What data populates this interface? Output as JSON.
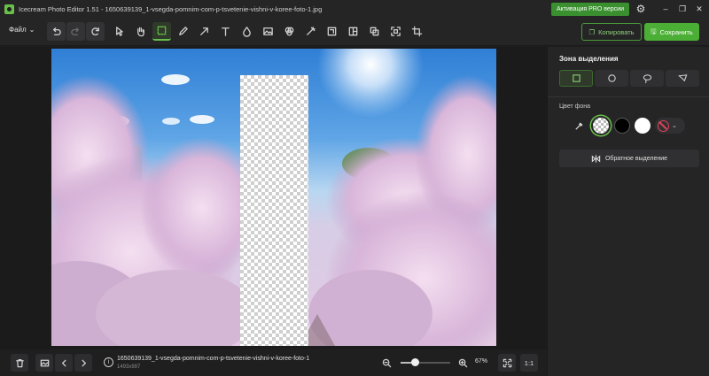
{
  "window": {
    "title": "Icecream Photo Editor 1.51 - 1650639139_1-vsegda-pomnim-com-p-tsvetenie-vishni-v-koree-foto-1.jpg",
    "pro_button": "Активация PRO версии",
    "minimize": "–",
    "maximize": "❐",
    "close": "✕",
    "gear_icon": "gear-icon"
  },
  "toolbar": {
    "file_menu": "Файл",
    "copy_label": "Копировать",
    "save_label": "Сохранить",
    "active_tool": "selection"
  },
  "canvas": {
    "image_description_shown": "cherry blossom photo with transparent vertical cut-out"
  },
  "bottombar": {
    "file_name": "1650639139_1-vsegda-pomnim-com-p-tsvetenie-vishni-v-koree-foto-1",
    "file_dims": "1493x997",
    "zoom": "67%",
    "zoom_level": 0.3,
    "one_to_one": "1:1"
  },
  "panel": {
    "title": "Зона выделения",
    "bg_color_label": "Цвет фона",
    "invert_selection": "Обратное выделение",
    "selected_bg": "transparent"
  },
  "colors": {
    "accent": "#4caf35",
    "pro_green": "#3a8f2f",
    "panel_bg": "#252526",
    "canvas_bg": "#1b1b1b"
  }
}
